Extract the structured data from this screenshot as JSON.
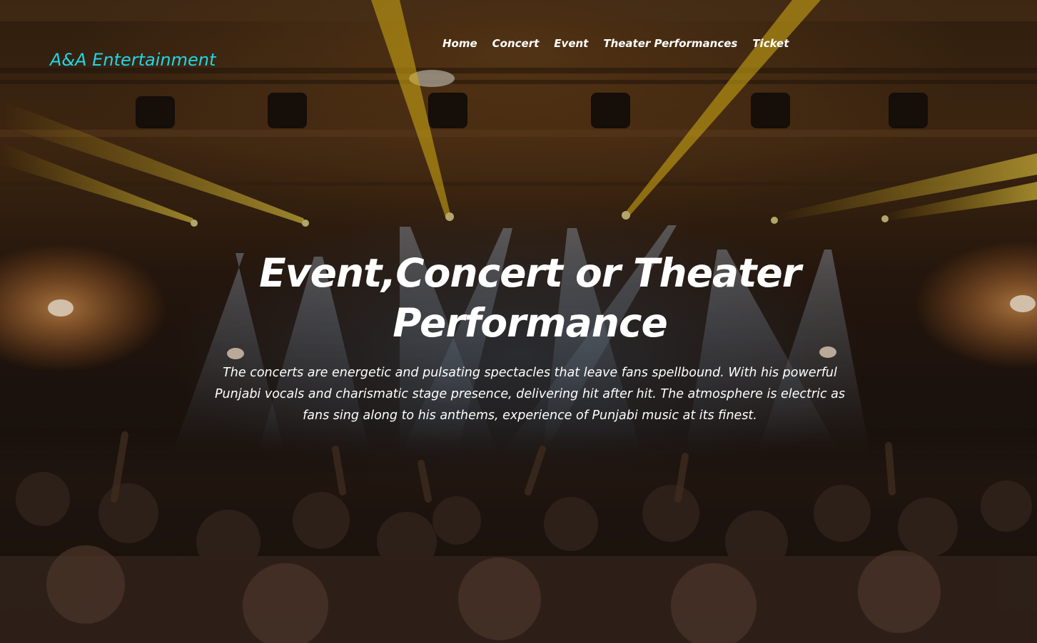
{
  "brand": {
    "name": "A&A Entertainment"
  },
  "nav": {
    "items": [
      "Home",
      "Concert",
      "Event",
      "Theater Performances",
      "Ticket"
    ]
  },
  "hero": {
    "headline": "Event,Concert or Theater Performance",
    "description": "The concerts are energetic and pulsating spectacles that leave fans spellbound. With his powerful Punjabi vocals and charismatic stage presence, delivering hit after hit. The atmosphere is electric as fans sing along to his anthems, experience of Punjabi music at its finest.",
    "background": "concert-crowd-stage-lights-photo"
  },
  "colors": {
    "brand": "#1fd6e6",
    "text": "#ffffff"
  }
}
